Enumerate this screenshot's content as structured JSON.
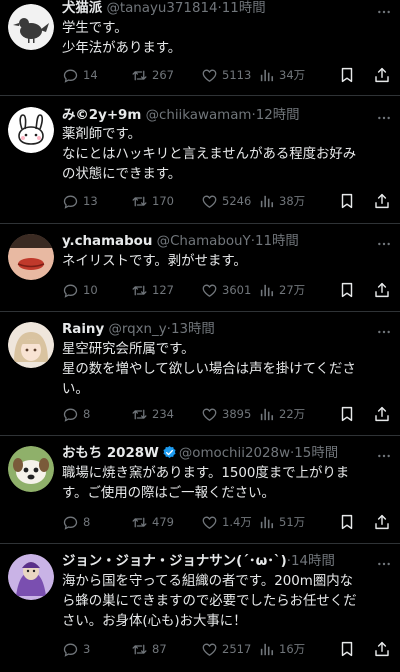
{
  "tweets": [
    {
      "name": "犬猫派",
      "handle": "@tanayu371814",
      "time": "11時間",
      "lines": [
        "学生です。",
        "少年法があります。"
      ],
      "replies": "14",
      "retweets": "267",
      "likes": "5113",
      "views": "34万",
      "verified": false
    },
    {
      "name": "み©2y+9m",
      "handle": "@chiikawamam",
      "time": "12時間",
      "lines": [
        "薬剤師です。",
        "なにとはハッキリと言えませんがある程度お好み",
        "の状態にできます。"
      ],
      "replies": "13",
      "retweets": "170",
      "likes": "5246",
      "views": "38万",
      "verified": false
    },
    {
      "name": "y.chamabou",
      "handle": "@ChamabouY",
      "time": "11時間",
      "lines": [
        "ネイリストです。剥がせます。"
      ],
      "replies": "10",
      "retweets": "127",
      "likes": "3601",
      "views": "27万",
      "verified": false
    },
    {
      "name": "Rainy",
      "handle": "@rqxn_y",
      "time": "13時間",
      "lines": [
        "星空研究会所属です。",
        "星の数を増やして欲しい場合は声を掛けてくださ",
        "い。"
      ],
      "replies": "8",
      "retweets": "234",
      "likes": "3895",
      "views": "22万",
      "verified": false
    },
    {
      "name": "おもち 2028W",
      "handle": "@omochii2028w",
      "time": "15時間",
      "lines": [
        "職場に焼き窯があります。1500度まで上がりま",
        "す。ご使用の際はご一報ください。"
      ],
      "replies": "8",
      "retweets": "479",
      "likes": "1.4万",
      "views": "51万",
      "verified": true
    },
    {
      "name": "ジョン・ジョナ・ジョナサン(´･ω･`)",
      "handle": "",
      "time": "14時間",
      "lines": [
        "海から国を守ってる組織の者です。200m圏内な",
        "ら蜂の巣にできますので必要でしたらお任せくだ",
        "さい。お身体(心も)お大事に！"
      ],
      "replies": "3",
      "retweets": "87",
      "likes": "2517",
      "views": "16万",
      "verified": false
    }
  ],
  "icons": {
    "reply": "reply-icon",
    "retweet": "retweet-icon",
    "like": "like-icon",
    "views": "views-icon",
    "bookmark": "bookmark-icon",
    "share": "share-icon",
    "more": "more-icon"
  },
  "colors": {
    "background": "#000000",
    "text": "#e7e9ea",
    "muted": "#71767b",
    "divider": "#2f3336",
    "verified": "#1d9bf0"
  }
}
